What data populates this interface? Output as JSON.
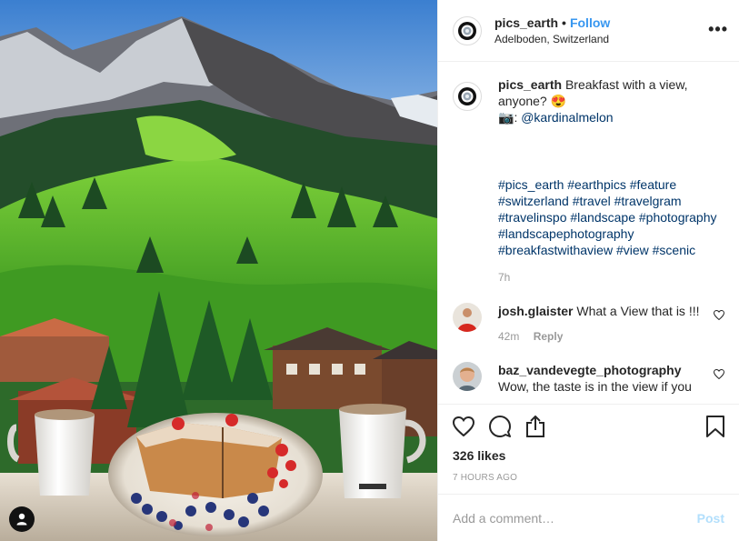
{
  "post": {
    "username": "pics_earth",
    "separator": "•",
    "follow_label": "Follow",
    "location": "Adelboden, Switzerland",
    "more_label": "•••"
  },
  "caption": {
    "username": "pics_earth",
    "text": "Breakfast with a view, anyone?",
    "emoji": "😍",
    "camera": "📷",
    "credit_prefix": ":",
    "credit_handle": "@kardinalmelon",
    "hashtags": "#pics_earth #earthpics #feature #switzerland #travel #travelgram #travelinspo #landscape #photography #landscapephotography #breakfastwithaview #view #scenic",
    "time": "7h"
  },
  "comments": [
    {
      "username": "josh.glaister",
      "text": "What a View that is !!!",
      "time": "42m",
      "reply_label": "Reply"
    },
    {
      "username": "baz_vandevegte_photography",
      "text": "Wow, the taste is in the view if you"
    }
  ],
  "actions": {
    "likes": "326 likes",
    "time_ago": "7 HOURS AGO"
  },
  "add_comment": {
    "placeholder": "Add a comment…",
    "post_label": "Post"
  },
  "colors": {
    "accent": "#3897f0",
    "link": "#003569",
    "muted": "#999999",
    "post_disabled": "#b2dffc"
  },
  "icons": [
    "user-tag-icon",
    "pics-earth-logo-icon",
    "more-options-icon",
    "heart-icon",
    "comment-icon",
    "share-icon",
    "bookmark-icon",
    "small-heart-icon"
  ]
}
